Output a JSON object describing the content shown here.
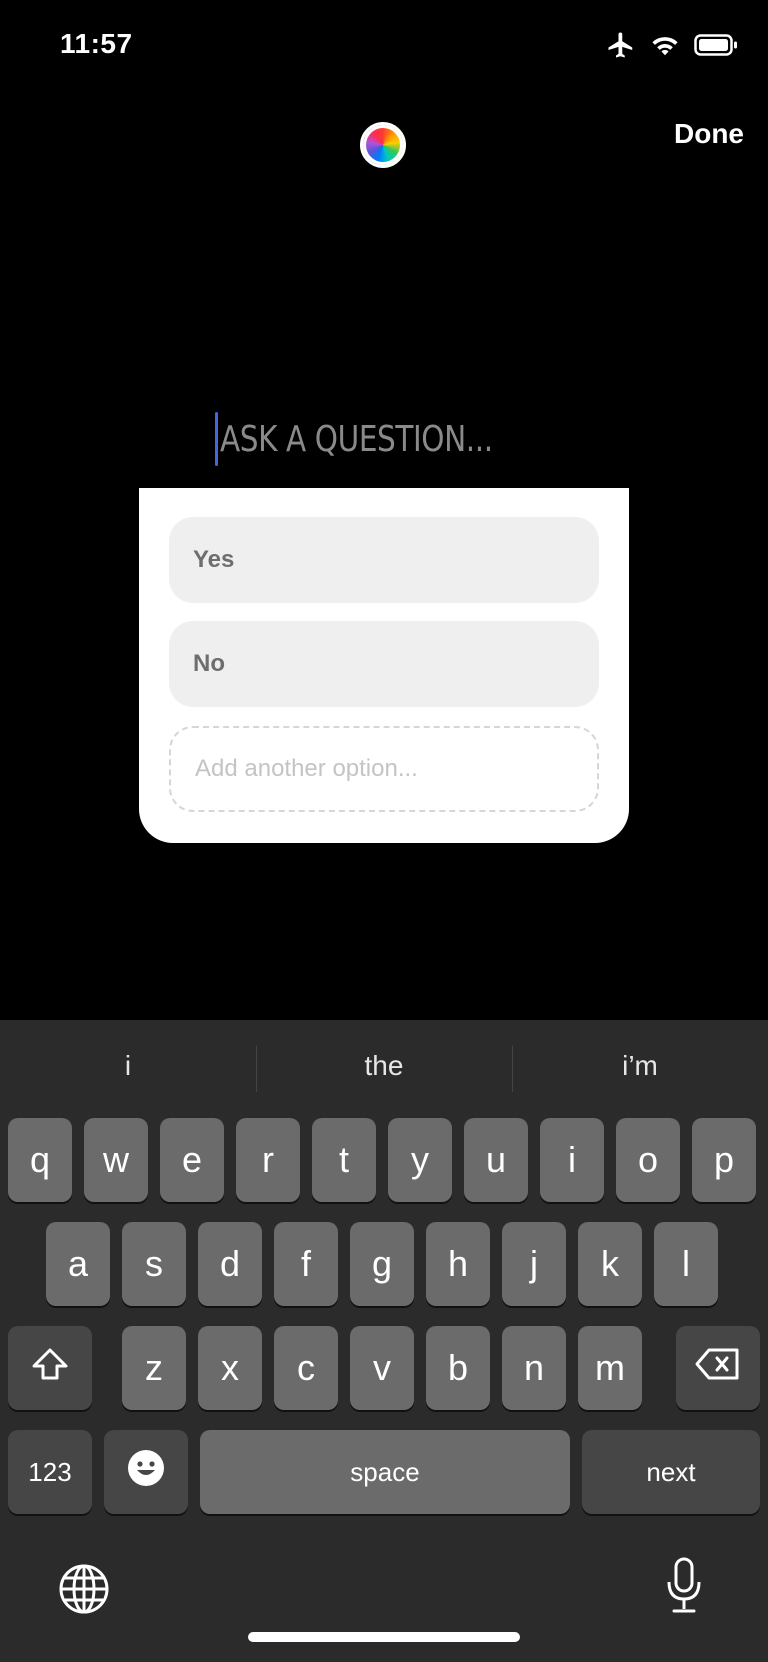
{
  "status": {
    "time": "11:57",
    "icons": [
      "airplane-icon",
      "wifi-icon",
      "battery-icon"
    ]
  },
  "top": {
    "color_wheel_icon": "color-wheel-icon",
    "done_label": "Done"
  },
  "question": {
    "placeholder": "ASK A QUESTION..."
  },
  "poll": {
    "options": [
      {
        "label": "Yes"
      },
      {
        "label": "No"
      }
    ],
    "add_placeholder": "Add another option..."
  },
  "keyboard": {
    "suggestions": [
      "i",
      "the",
      "i’m"
    ],
    "row1": [
      "q",
      "w",
      "e",
      "r",
      "t",
      "y",
      "u",
      "i",
      "o",
      "p"
    ],
    "row2": [
      "a",
      "s",
      "d",
      "f",
      "g",
      "h",
      "j",
      "k",
      "l"
    ],
    "row3": [
      "z",
      "x",
      "c",
      "v",
      "b",
      "n",
      "m"
    ],
    "numbers_label": "123",
    "space_label": "space",
    "next_label": "next"
  },
  "colors": {
    "caret": "#4a63e0",
    "key": "#6b6b6b",
    "key_dark": "#464646",
    "keyboard_bg": "#2b2b2b"
  }
}
